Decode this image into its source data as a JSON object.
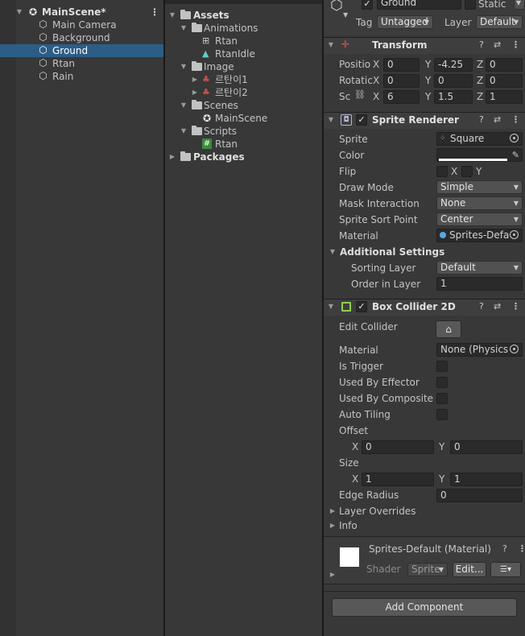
{
  "hierarchy": {
    "scene": "MainScene*",
    "items": [
      {
        "label": "Main Camera",
        "selected": false
      },
      {
        "label": "Background",
        "selected": false
      },
      {
        "label": "Ground",
        "selected": true
      },
      {
        "label": "Rtan",
        "selected": false
      },
      {
        "label": "Rain",
        "selected": false
      }
    ]
  },
  "project": {
    "assets": "Assets",
    "animations": "Animations",
    "anim_rtan": "Rtan",
    "anim_rtanidle": "RtanIdle",
    "image": "Image",
    "img1": "르탄이1",
    "img2": "르탄이2",
    "scenes": "Scenes",
    "scene_main": "MainScene",
    "scripts": "Scripts",
    "script_rtan": "Rtan",
    "packages": "Packages"
  },
  "inspector": {
    "object_name": "Ground",
    "static_label": "Static",
    "tag_label": "Tag",
    "tag_value": "Untagged",
    "layer_label": "Layer",
    "layer_value": "Default",
    "transform": {
      "title": "Transform",
      "position_label": "Positio",
      "rotation_label": "Rotatic",
      "scale_label": "Sc",
      "x": "X",
      "y": "Y",
      "z": "Z",
      "position": [
        "0",
        "-4.25",
        "0"
      ],
      "rotation": [
        "0",
        "0",
        "0"
      ],
      "scale": [
        "6",
        "1.5",
        "1"
      ]
    },
    "sprite_renderer": {
      "title": "Sprite Renderer",
      "sprite_label": "Sprite",
      "sprite_value": "Square",
      "color_label": "Color",
      "color_value": "#ffffff",
      "flip_label": "Flip",
      "flip_x": "X",
      "flip_y": "Y",
      "draw_mode_label": "Draw Mode",
      "draw_mode_value": "Simple",
      "mask_label": "Mask Interaction",
      "mask_value": "None",
      "sort_point_label": "Sprite Sort Point",
      "sort_point_value": "Center",
      "material_label": "Material",
      "material_value": "Sprites-Defa",
      "additional_label": "Additional Settings",
      "sorting_layer_label": "Sorting Layer",
      "sorting_layer_value": "Default",
      "order_label": "Order in Layer",
      "order_value": "1"
    },
    "box_collider": {
      "title": "Box Collider 2D",
      "edit_collider_label": "Edit Collider",
      "material_label": "Material",
      "material_value": "None (Physics",
      "is_trigger_label": "Is Trigger",
      "used_by_effector_label": "Used By Effector",
      "used_by_composite_label": "Used By Composite",
      "auto_tiling_label": "Auto Tiling",
      "offset_label": "Offset",
      "x": "X",
      "y": "Y",
      "offset": [
        "0",
        "0"
      ],
      "size_label": "Size",
      "size": [
        "1",
        "1"
      ],
      "edge_radius_label": "Edge Radius",
      "edge_radius_value": "0",
      "layer_overrides_label": "Layer Overrides",
      "info_label": "Info"
    },
    "material_preview": {
      "name": "Sprites-Default (Material)",
      "shader_label": "Shader",
      "shader_value": "Sprite",
      "edit_label": "Edit..."
    },
    "add_component_label": "Add Component"
  },
  "colors": {
    "selection": "#2c5d87",
    "background": "#383838",
    "field": "#2a2a2a"
  }
}
